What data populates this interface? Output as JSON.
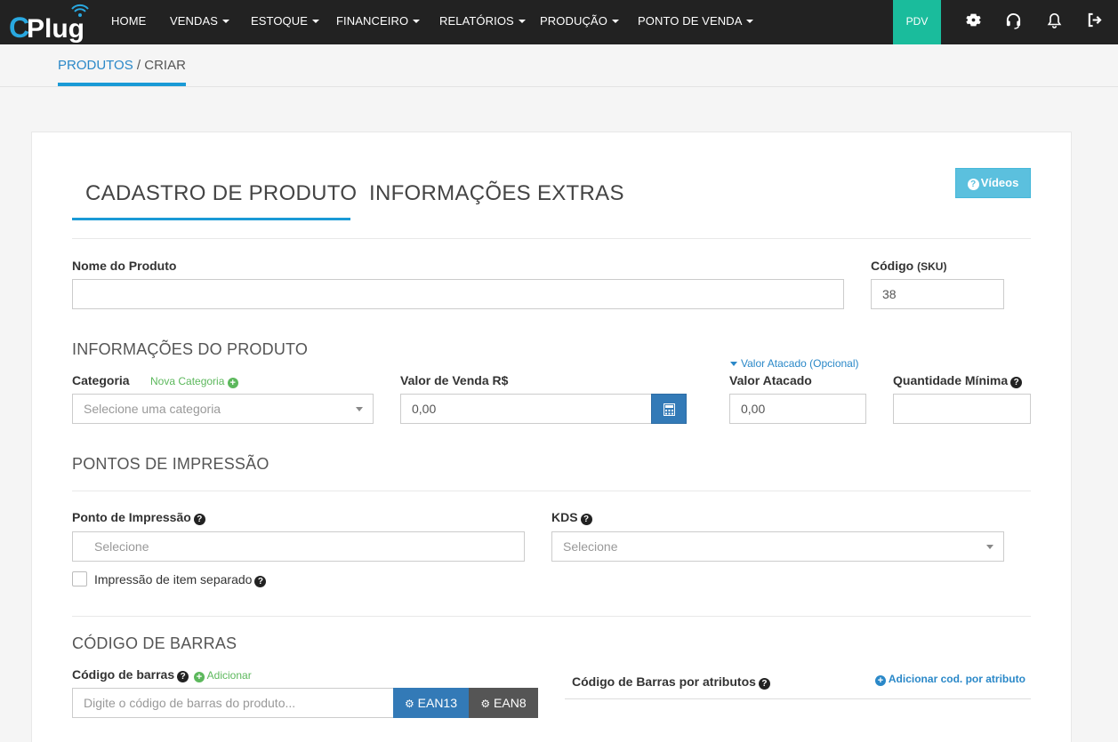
{
  "app": {
    "logo_text": "C Plug"
  },
  "nav": {
    "home": "HOME",
    "vendas": "VENDAS",
    "estoque": "ESTOQUE",
    "financeiro": "FINANCEIRO",
    "relatorios": "RELATÓRIOS",
    "producao": "PRODUÇÃO",
    "ponto_venda": "PONTO DE VENDA",
    "pdv": "PDV",
    "icons": [
      "gear-icon",
      "headset-icon",
      "bell-icon",
      "logout-icon"
    ]
  },
  "breadcrumb": {
    "parent": "PRODUTOS",
    "separator": " / ",
    "current": "CRIAR"
  },
  "tabs": {
    "cadastro": "CADASTRO DE PRODUTO",
    "extras": "INFORMAÇÕES EXTRAS"
  },
  "videos_button": "Vídeos",
  "form": {
    "nome_label": "Nome do Produto",
    "nome_value": "",
    "codigo_label": "Código",
    "codigo_suffix": "(SKU)",
    "codigo_value": "38",
    "info_section": "INFORMAÇÕES DO PRODUTO",
    "categoria_label": "Categoria",
    "nova_categoria": "Nova Categoria",
    "categoria_placeholder": "Selecione uma categoria",
    "valor_venda_label": "Valor de Venda R$",
    "valor_venda_value": "0,00",
    "valor_atacado_toggle": "Valor Atacado (Opcional)",
    "valor_atacado_label": "Valor Atacado",
    "valor_atacado_value": "0,00",
    "qtd_minima_label": "Quantidade Mínima",
    "qtd_minima_value": "",
    "impressao_section": "PONTOS DE IMPRESSÃO",
    "ponto_impressao_label": "Ponto de Impressão",
    "ponto_impressao_placeholder": "Selecione",
    "kds_label": "KDS",
    "kds_placeholder": "Selecione",
    "item_separado_label": "Impressão de item separado",
    "item_separado_checked": false,
    "barras_section": "CÓDIGO DE BARRAS",
    "barras_label": "Código de barras",
    "barras_adicionar": "Adicionar",
    "barras_placeholder": "Digite o código de barras do produto...",
    "ean13": "EAN13",
    "ean8": "EAN8",
    "barras_atributos_label": "Código de Barras por atributos",
    "adicionar_atributo": "Adicionar cod. por atributo"
  },
  "colors": {
    "topbar": "#222222",
    "pdv": "#1abc9c",
    "accent": "#1a9ad6",
    "videos_btn": "#5bc0de",
    "calc_btn": "#337ab7",
    "ean13_btn": "#337ab7",
    "ean8_btn": "#555555",
    "green_link": "#5cb85c"
  }
}
